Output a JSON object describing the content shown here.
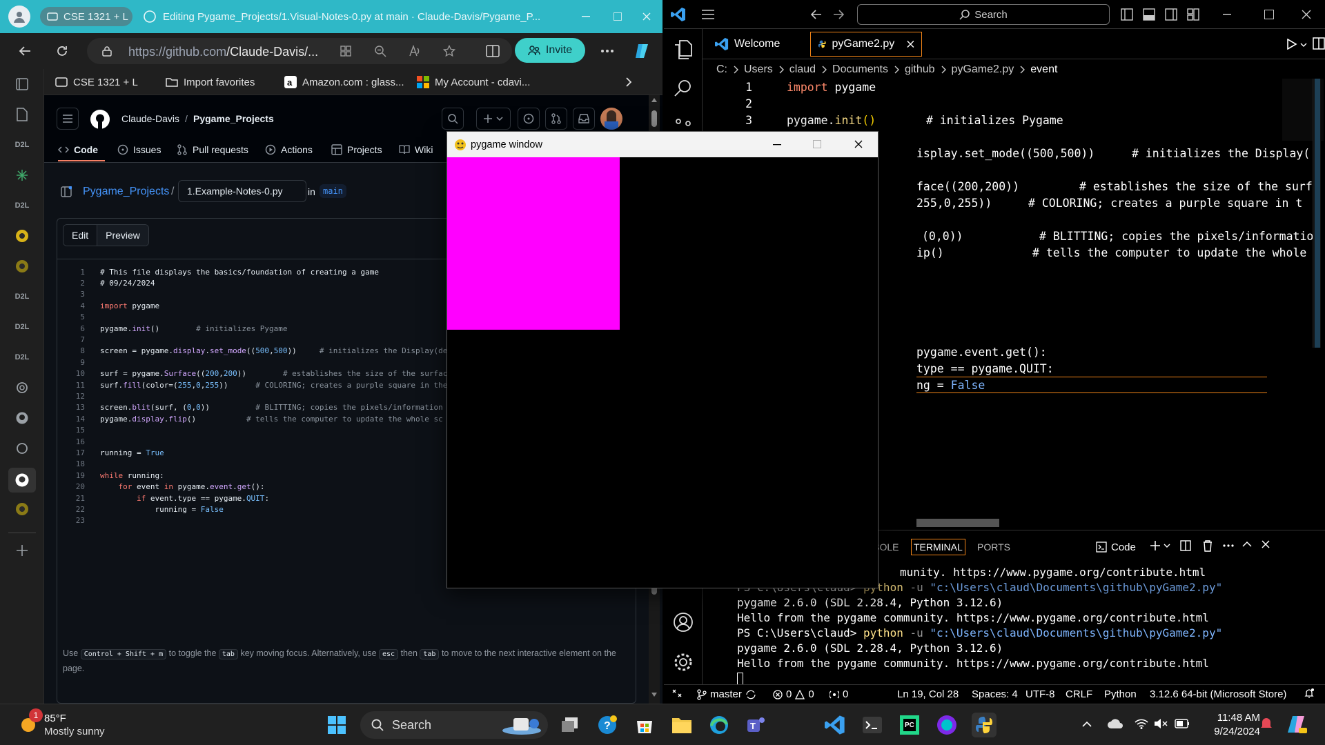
{
  "edge": {
    "tab_group": "CSE 1321 + L",
    "tab_title": "Editing Pygame_Projects/1.Visual-Notes-0.py at main · Claude-Davis/Pygame_P...",
    "url_host": "https://github.com",
    "url_path": "/Claude-Davis/...",
    "invite_label": "Invite",
    "favorites": [
      {
        "label": "CSE 1321 + L"
      },
      {
        "label": "Import favorites"
      },
      {
        "label": "Amazon.com : glass..."
      },
      {
        "label": "My Account - cdavi..."
      }
    ],
    "sidebar_labels": [
      "D2L",
      "D2L",
      "D2L",
      "D2L",
      "D2L"
    ]
  },
  "github": {
    "owner": "Claude-Davis",
    "separator": "/",
    "repo": "Pygame_Projects",
    "tabs": [
      "Code",
      "Issues",
      "Pull requests",
      "Actions",
      "Projects",
      "Wiki"
    ],
    "path_repo": "Pygame_Projects",
    "path_sep": "/",
    "filename": "1.Example-Notes-0.py",
    "in_label": "in",
    "branch": "main",
    "edit_tab": "Edit",
    "preview_tab": "Preview",
    "hint": {
      "use": "Use",
      "keys1": "Control + Shift + m",
      "t1": "to toggle the",
      "tab": "tab",
      "t2": "key moving focus. Alternatively, use",
      "esc": "esc",
      "then": "then",
      "tab2": "tab",
      "t3": "to move to the next interactive element on the page."
    }
  },
  "gh_code_lines": [
    "1",
    "2",
    "3",
    "4",
    "5",
    "6",
    "7",
    "8",
    "9",
    "10",
    "11",
    "12",
    "13",
    "14",
    "15",
    "16",
    "17",
    "18",
    "19",
    "20",
    "21",
    "22",
    "23"
  ],
  "gh_code": {
    "l1": "# This file displays the basics/foundation of creating a game",
    "l2": "# 09/24/2024",
    "l8_cm": "# initializes the Display(de",
    "l10_cm": "# establishes the size of the surface",
    "l11_cm": "# COLORING; creates a purple square in the",
    "l13_cm": "# BLITTING; copies the pixels/information",
    "l14_cm": "# tells the computer to update the whole sc",
    "l6_cm": "# initializes Pygame"
  },
  "pygame": {
    "title": "pygame window",
    "surface_color": "#ff00ff"
  },
  "vscode": {
    "search": "Search",
    "tabs": [
      {
        "label": "Welcome"
      },
      {
        "label": "pyGame2.py"
      }
    ],
    "breadcrumbs": [
      "C:",
      "Users",
      "claud",
      "Documents",
      "github",
      "pyGame2.py",
      "event"
    ],
    "editor": {
      "l1_kw": "import",
      "l1_rest": " pygame",
      "l3_a": "pygame.",
      "l3_fn": "init",
      "l3_p": "()",
      "l3_cm": "# initializes Pygame",
      "l5_a": "isplay.set_mode((500,500))",
      "l5_cm": "# initializes the Display(",
      "l7_a": "face((200,200))",
      "l7_cm": "# establishes the size of the surf",
      "l8_a": "255,0,255))",
      "l8_cm": "# COLORING; creates a purple square in t",
      "l10_a": "(0,0))",
      "l10_cm": "# BLITTING; copies the pixels/informatio",
      "l11_a": "ip()",
      "l11_cm": "# tells the computer to update the whole",
      "l17_a": "pygame.event.get():",
      "l18_a": "type == pygame.QUIT:",
      "l19_a": "ng = ",
      "l19_b": "False"
    },
    "line_numbers": [
      "1",
      "2",
      "3"
    ],
    "panel_tabs": [
      "CONSOLE",
      "TERMINAL",
      "PORTS"
    ],
    "panel_code_label": "Code",
    "terminal": {
      "t1": "munity. https://www.pygame.org/contribute.html",
      "t2a": "PS C:\\Users\\claud> ",
      "t2b": "python",
      "t2c": " -u ",
      "t2d": "\"c:\\Users\\claud\\Documents\\github\\pyGame2.py\"",
      "t3": "pygame 2.6.0 (SDL 2.28.4, Python 3.12.6)",
      "t4": "Hello from the pygame community. https://www.pygame.org/contribute.html",
      "t5a": "PS C:\\Users\\claud> ",
      "t5b": "python",
      "t5c": " -u ",
      "t5d": "\"c:\\Users\\claud\\Documents\\github\\pyGame2.py\"",
      "t6": "pygame 2.6.0 (SDL 2.28.4, Python 3.12.6)",
      "t7": "Hello from the pygame community. https://www.pygame.org/contribute.html"
    },
    "status": {
      "branch": "master",
      "errors": "0",
      "warnings": "0",
      "ports": "0",
      "position": "Ln 19, Col 28",
      "spaces": "Spaces: 4",
      "encoding": "UTF-8",
      "eol": "CRLF",
      "language": "Python",
      "interpreter": "3.12.6 64-bit (Microsoft Store)"
    }
  },
  "taskbar": {
    "weather_temp": "85°F",
    "weather_desc": "Mostly sunny",
    "weather_badge": "1",
    "search_label": "Search",
    "time": "11:48 AM",
    "date": "9/24/2024"
  }
}
